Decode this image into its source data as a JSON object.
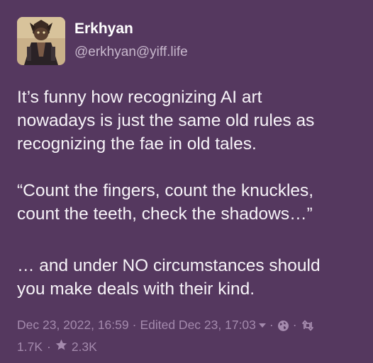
{
  "account": {
    "display_name": "Erkhyan",
    "handle": "@erkhyan@yiff.life"
  },
  "post": {
    "paragraphs": [
      [
        "It’s funny how recognizing AI art",
        "nowadays is just the same old rules as",
        "recognizing the fae in old tales."
      ],
      [
        "“Count the fingers, count the knuckles,",
        "count the teeth, check the shadows…”"
      ],
      [
        "… and under NO circumstances should",
        "you make deals with their kind."
      ]
    ]
  },
  "meta": {
    "date": "Dec 23, 2022, 16:59",
    "separator": "·",
    "edited": "Edited Dec 23, 17:03",
    "boosts": "1.7K",
    "favourites": "2.3K"
  },
  "icons": {
    "edited_dropdown": "caret-down-icon",
    "visibility": "globe-icon",
    "boost": "boost-icon",
    "favourite": "star-icon"
  },
  "colors": {
    "background": "#55385f",
    "text": "#f7f3f8",
    "muted": "#a48aad"
  }
}
